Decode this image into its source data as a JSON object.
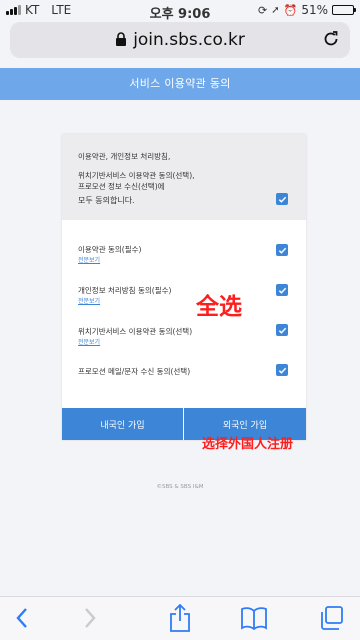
{
  "status_bar": {
    "carrier": "KT",
    "network": "LTE",
    "time": "오후 9:06",
    "battery_percent": "51%",
    "battery_level": 0.51
  },
  "browser": {
    "url": "join.sbs.co.kr"
  },
  "header": {
    "title": "서비스 이용약관 동의"
  },
  "agree_all": {
    "line1": "이용약관, 개인정보 처리방침,",
    "line2": "위치기반서비스 이용약관 동의(선택),",
    "line3": "프로모션 정보 수신(선택)에",
    "line4": "모두 동의합니다.",
    "checked": true
  },
  "terms": [
    {
      "label": "이용약관 동의(필수)",
      "detail": "전문보기",
      "checked": true
    },
    {
      "label": "개인정보 처리방침 동의(필수)",
      "detail": "전문보기",
      "checked": true
    },
    {
      "label": "위치기반서비스 이용약관 동의(선택)",
      "detail": "전문보기",
      "checked": true
    },
    {
      "label": "프로모션 메일/문자 수신 동의(선택)",
      "detail": "",
      "checked": true
    }
  ],
  "buttons": {
    "domestic": "내국인 가입",
    "foreign": "외국인 가입"
  },
  "annotations": {
    "select_all": "全选",
    "select_foreign": "选择外国人注册"
  },
  "footer": {
    "copyright": "©SBS & SBS I&M"
  },
  "colors": {
    "accent": "#3d86d7",
    "header_band": "#6ea7ea",
    "annotation": "#ff1e1e"
  },
  "icons": {
    "toolbar": [
      "back-icon",
      "share-icon",
      "bookmarks-icon",
      "tabs-icon"
    ]
  }
}
